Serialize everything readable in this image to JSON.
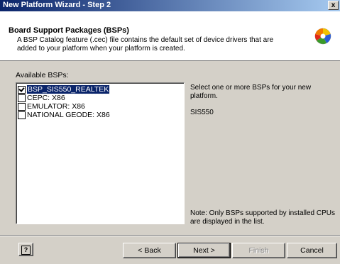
{
  "window": {
    "title": "New Platform Wizard - Step 2",
    "close_glyph": "x"
  },
  "header": {
    "title": "Board Support Packages (BSPs)",
    "description": "A BSP Catalog feature (.cec) file contains the default set of device drivers that are added to your platform when your platform is created.",
    "icon": "wizard-ball-icon"
  },
  "bsp": {
    "label": "Available BSPs:",
    "items": [
      {
        "label": "BSP_SIS550_REALTEK",
        "checked": true,
        "selected": true
      },
      {
        "label": "CEPC: X86",
        "checked": false,
        "selected": false
      },
      {
        "label": "EMULATOR: X86",
        "checked": false,
        "selected": false
      },
      {
        "label": "NATIONAL GEODE: X86",
        "checked": false,
        "selected": false
      }
    ]
  },
  "info": {
    "instruction": "Select one or more BSPs for your new platform.",
    "selected_name": "SIS550",
    "note": "Note:  Only BSPs supported by installed CPUs are displayed in the list."
  },
  "buttons": {
    "help": "?",
    "back": "< Back",
    "next": "Next >",
    "finish": "Finish",
    "cancel": "Cancel"
  },
  "colors": {
    "title_bar": "#0a246a",
    "selection": "#0a246a",
    "face": "#d4d0c8"
  }
}
